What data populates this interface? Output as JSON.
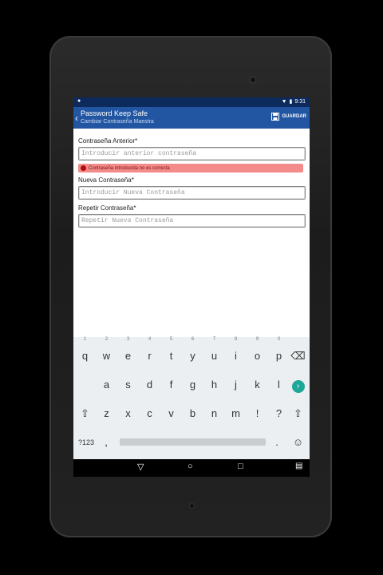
{
  "status": {
    "time": "9:31"
  },
  "app": {
    "title": "Password Keep Safe",
    "subtitle": "Cambiar Contraseña Maestra",
    "save_label": "GUARDAR"
  },
  "form": {
    "old_label": "Contraseña Anterior*",
    "old_placeholder": "Introducir anterior contraseña",
    "error": "Contraseña introducida no es correcta",
    "new_label": "Nueva Contraseña*",
    "new_placeholder": "Introducir Nueva Contraseña",
    "repeat_label": "Repetir Contraseña*",
    "repeat_placeholder": "Repetir Nueva Contraseña"
  },
  "keyboard": {
    "row1": [
      "q",
      "w",
      "e",
      "r",
      "t",
      "y",
      "u",
      "i",
      "o",
      "p"
    ],
    "row1_numbers": [
      "1",
      "2",
      "3",
      "4",
      "5",
      "6",
      "7",
      "8",
      "9",
      "0"
    ],
    "row2": [
      "a",
      "s",
      "d",
      "f",
      "g",
      "h",
      "j",
      "k",
      "l",
      "ñ"
    ],
    "row3": [
      "z",
      "x",
      "c",
      "v",
      "b",
      "n",
      "m",
      "!",
      "?"
    ],
    "symbols_key": "?123",
    "comma": ",",
    "period": "."
  }
}
